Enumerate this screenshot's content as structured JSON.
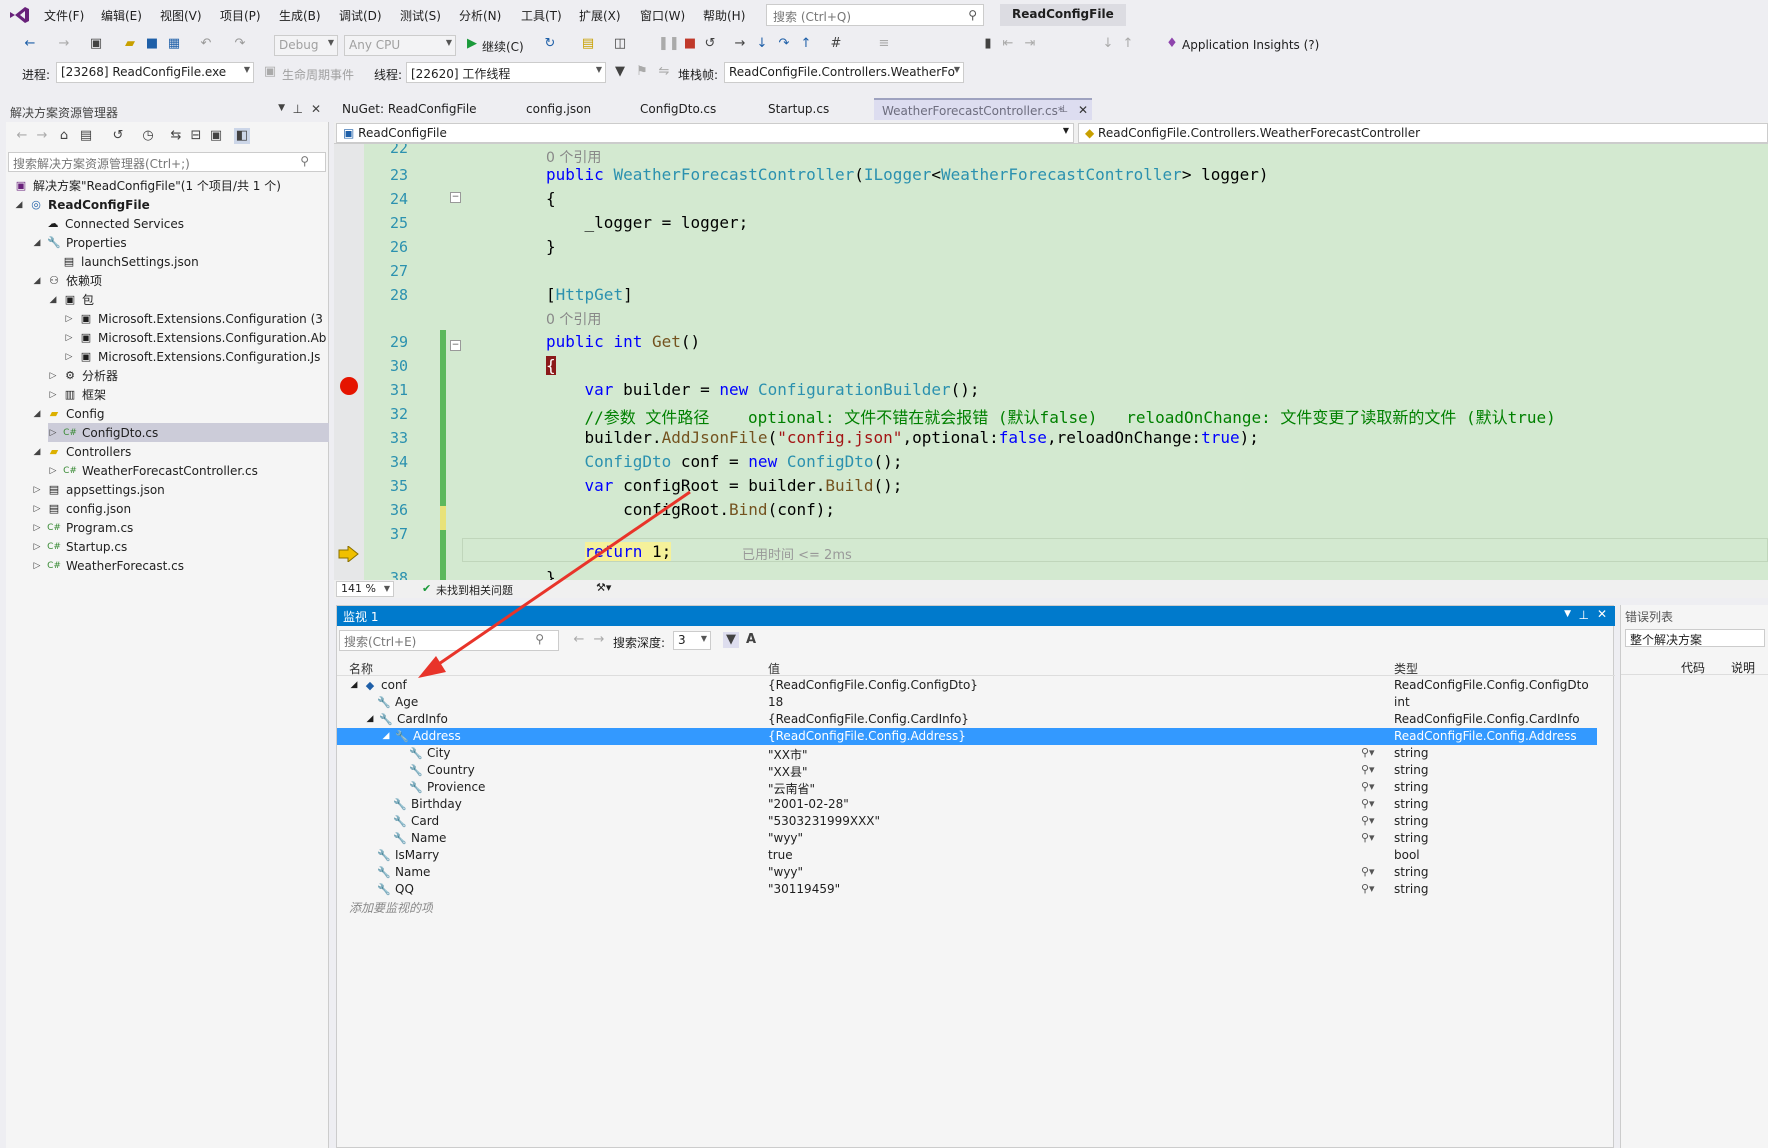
{
  "menu": [
    "文件(F)",
    "编辑(E)",
    "视图(V)",
    "项目(P)",
    "生成(B)",
    "调试(D)",
    "测试(S)",
    "分析(N)",
    "工具(T)",
    "扩展(X)",
    "窗口(W)",
    "帮助(H)"
  ],
  "search": {
    "placeholder": "搜索 (Ctrl+Q)"
  },
  "app_title": "ReadConfigFile",
  "toolbar1": {
    "config": "Debug",
    "platform": "Any CPU",
    "continue_label": "继续(C)",
    "insights_label": "Application Insights (?)"
  },
  "toolbar2": {
    "process_label": "进程:",
    "process_value": "[23268] ReadConfigFile.exe",
    "lifecycle_label": "生命周期事件",
    "thread_label": "线程:",
    "thread_value": "[22620] 工作线程",
    "stack_label": "堆栈帧:",
    "stack_value": "ReadConfigFile.Controllers.WeatherFo"
  },
  "solution_explorer": {
    "title": "解决方案资源管理器",
    "search_placeholder": "搜索解决方案资源管理器(Ctrl+;)",
    "items": [
      {
        "label": "解决方案\"ReadConfigFile\"(1 个项目/共 1 个)"
      },
      {
        "label": "ReadConfigFile"
      },
      {
        "label": "Connected Services"
      },
      {
        "label": "Properties"
      },
      {
        "label": "launchSettings.json"
      },
      {
        "label": "依赖项"
      },
      {
        "label": "包"
      },
      {
        "label": "Microsoft.Extensions.Configuration (3"
      },
      {
        "label": "Microsoft.Extensions.Configuration.Ab"
      },
      {
        "label": "Microsoft.Extensions.Configuration.Js"
      },
      {
        "label": "分析器"
      },
      {
        "label": "框架"
      },
      {
        "label": "Config"
      },
      {
        "label": "ConfigDto.cs"
      },
      {
        "label": "Controllers"
      },
      {
        "label": "WeatherForecastController.cs"
      },
      {
        "label": "appsettings.json"
      },
      {
        "label": "config.json"
      },
      {
        "label": "Program.cs"
      },
      {
        "label": "Startup.cs"
      },
      {
        "label": "WeatherForecast.cs"
      }
    ]
  },
  "tabs": [
    "NuGet: ReadConfigFile",
    "config.json",
    "ConfigDto.cs",
    "Startup.cs",
    "WeatherForecastController.cs*"
  ],
  "navbar": {
    "project": "ReadConfigFile",
    "member": "ReadConfigFile.Controllers.WeatherForecastController"
  },
  "editor": {
    "line_numbers": [
      "22",
      "23",
      "24",
      "25",
      "26",
      "27",
      "28",
      "29",
      "30",
      "31",
      "32",
      "33",
      "34",
      "35",
      "36",
      "37",
      "38"
    ],
    "refs_label": "0 个引用",
    "elapsed_hint": "已用时间 <= 2ms",
    "zoom": "141 %",
    "issues": "未找到相关问题"
  },
  "watch": {
    "title": "监视 1",
    "search_placeholder": "搜索(Ctrl+E)",
    "depth_label": "搜索深度:",
    "depth_value": "3",
    "columns": [
      "名称",
      "值",
      "类型"
    ],
    "rows": [
      {
        "name": "conf",
        "value": "{ReadConfigFile.Config.ConfigDto}",
        "type": "ReadConfigFile.Config.ConfigDto"
      },
      {
        "name": "Age",
        "value": "18",
        "type": "int"
      },
      {
        "name": "CardInfo",
        "value": "{ReadConfigFile.Config.CardInfo}",
        "type": "ReadConfigFile.Config.CardInfo"
      },
      {
        "name": "Address",
        "value": "{ReadConfigFile.Config.Address}",
        "type": "ReadConfigFile.Config.Address"
      },
      {
        "name": "City",
        "value": "\"XX市\"",
        "type": "string"
      },
      {
        "name": "Country",
        "value": "\"XX县\"",
        "type": "string"
      },
      {
        "name": "Provience",
        "value": "\"云南省\"",
        "type": "string"
      },
      {
        "name": "Birthday",
        "value": "\"2001-02-28\"",
        "type": "string"
      },
      {
        "name": "Card",
        "value": "\"5303231999XXX\"",
        "type": "string"
      },
      {
        "name": "Name",
        "value": "\"wyy\"",
        "type": "string"
      },
      {
        "name": "IsMarry",
        "value": "true",
        "type": "bool"
      },
      {
        "name": "Name",
        "value": "\"wyy\"",
        "type": "string"
      },
      {
        "name": "QQ",
        "value": "\"30119459\"",
        "type": "string"
      }
    ],
    "add_hint": "添加要监视的项"
  },
  "error_list": {
    "title": "错误列表",
    "scope": "整个解决方案",
    "col_code": "代码",
    "col_desc": "说明"
  },
  "colors": {
    "accent": "#007acc",
    "editor_bg": "#d3e9d0",
    "breakpoint": "#e51400",
    "annotation": "#e8342a"
  }
}
